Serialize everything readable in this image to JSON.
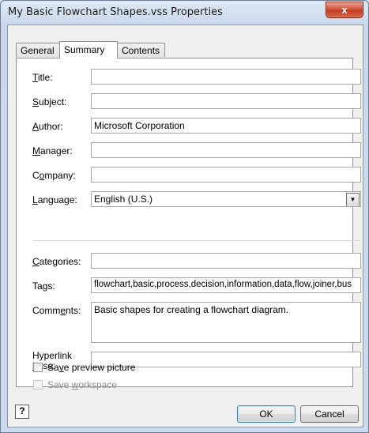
{
  "window": {
    "title": "My Basic Flowchart Shapes.vss Properties",
    "close_symbol": "x"
  },
  "tabs": [
    {
      "label": "General",
      "active": false
    },
    {
      "label": "Summary",
      "active": true
    },
    {
      "label": "Contents",
      "active": false
    }
  ],
  "fields": {
    "title": {
      "label_pre": "",
      "label_u": "T",
      "label_post": "itle:",
      "value": ""
    },
    "subject": {
      "label_pre": "",
      "label_u": "S",
      "label_post": "ubject:",
      "value": ""
    },
    "author": {
      "label_pre": "",
      "label_u": "A",
      "label_post": "uthor:",
      "value": "Microsoft Corporation"
    },
    "manager": {
      "label_pre": "",
      "label_u": "M",
      "label_post": "anager:",
      "value": ""
    },
    "company": {
      "label_pre": "C",
      "label_u": "o",
      "label_post": "mpany:",
      "value": ""
    },
    "language": {
      "label_pre": "",
      "label_u": "L",
      "label_post": "anguage:",
      "value": "English (U.S.)"
    },
    "categories": {
      "label_pre": "",
      "label_u": "C",
      "label_post": "ategories:",
      "value": ""
    },
    "tags": {
      "label_pre": "Ta",
      "label_u": "g",
      "label_post": "s:",
      "value": "flowchart,basic,process,decision,information,data,flow,joiner,bus"
    },
    "comments": {
      "label_pre": "Comm",
      "label_u": "e",
      "label_post": "nts:",
      "value": "Basic shapes for creating a flowchart diagram."
    },
    "hyperlink": {
      "label_line1": "Hyperlink",
      "label_pre": "",
      "label_u": "b",
      "label_post": "ase:",
      "value": ""
    }
  },
  "checkboxes": {
    "save_preview": {
      "pre": "Sa",
      "u": "v",
      "post": "e preview picture",
      "checked": false,
      "enabled": true
    },
    "save_workspace": {
      "pre": "Save ",
      "u": "w",
      "post": "orkspace",
      "checked": false,
      "enabled": false
    }
  },
  "buttons": {
    "help_symbol": "?",
    "ok": "OK",
    "cancel": "Cancel"
  }
}
